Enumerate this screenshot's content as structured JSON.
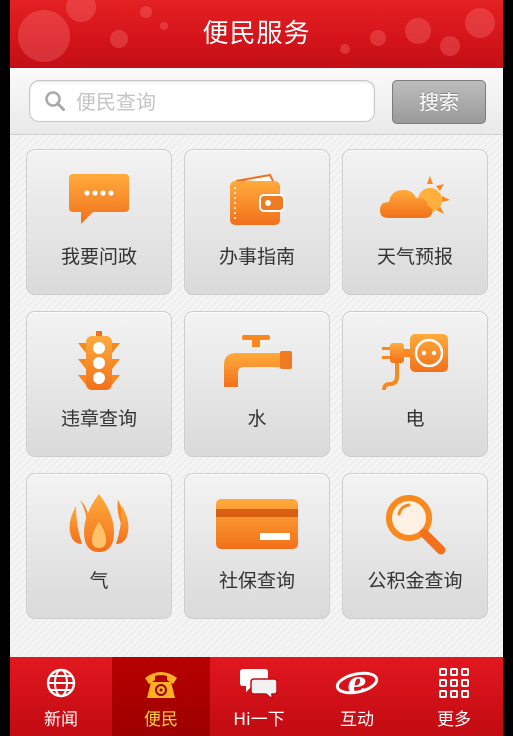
{
  "header": {
    "title": "便民服务"
  },
  "search": {
    "placeholder": "便民查询",
    "value": "",
    "button_label": "搜索"
  },
  "tiles": [
    {
      "label": "我要问政",
      "icon": "chat-bubble-icon"
    },
    {
      "label": "办事指南",
      "icon": "wallet-icon"
    },
    {
      "label": "天气预报",
      "icon": "weather-sun-cloud-icon"
    },
    {
      "label": "违章查询",
      "icon": "traffic-light-icon"
    },
    {
      "label": "水",
      "icon": "water-faucet-icon"
    },
    {
      "label": "电",
      "icon": "power-socket-plug-icon"
    },
    {
      "label": "气",
      "icon": "gas-flame-icon"
    },
    {
      "label": "社保查询",
      "icon": "credit-card-icon"
    },
    {
      "label": "公积金查询",
      "icon": "magnifier-icon"
    }
  ],
  "tabbar": {
    "active": "便民",
    "items": [
      {
        "label": "新闻",
        "icon": "globe-icon"
      },
      {
        "label": "便民",
        "icon": "telephone-icon"
      },
      {
        "label": "Hi一下",
        "icon": "chat-bubbles-icon"
      },
      {
        "label": "互动",
        "icon": "browser-e-icon"
      },
      {
        "label": "更多",
        "icon": "grid-dots-icon"
      }
    ]
  },
  "colors": {
    "brand_red": "#d3141a",
    "icon_orange": "#f7891f",
    "active_tab_text": "#ffd23e"
  }
}
